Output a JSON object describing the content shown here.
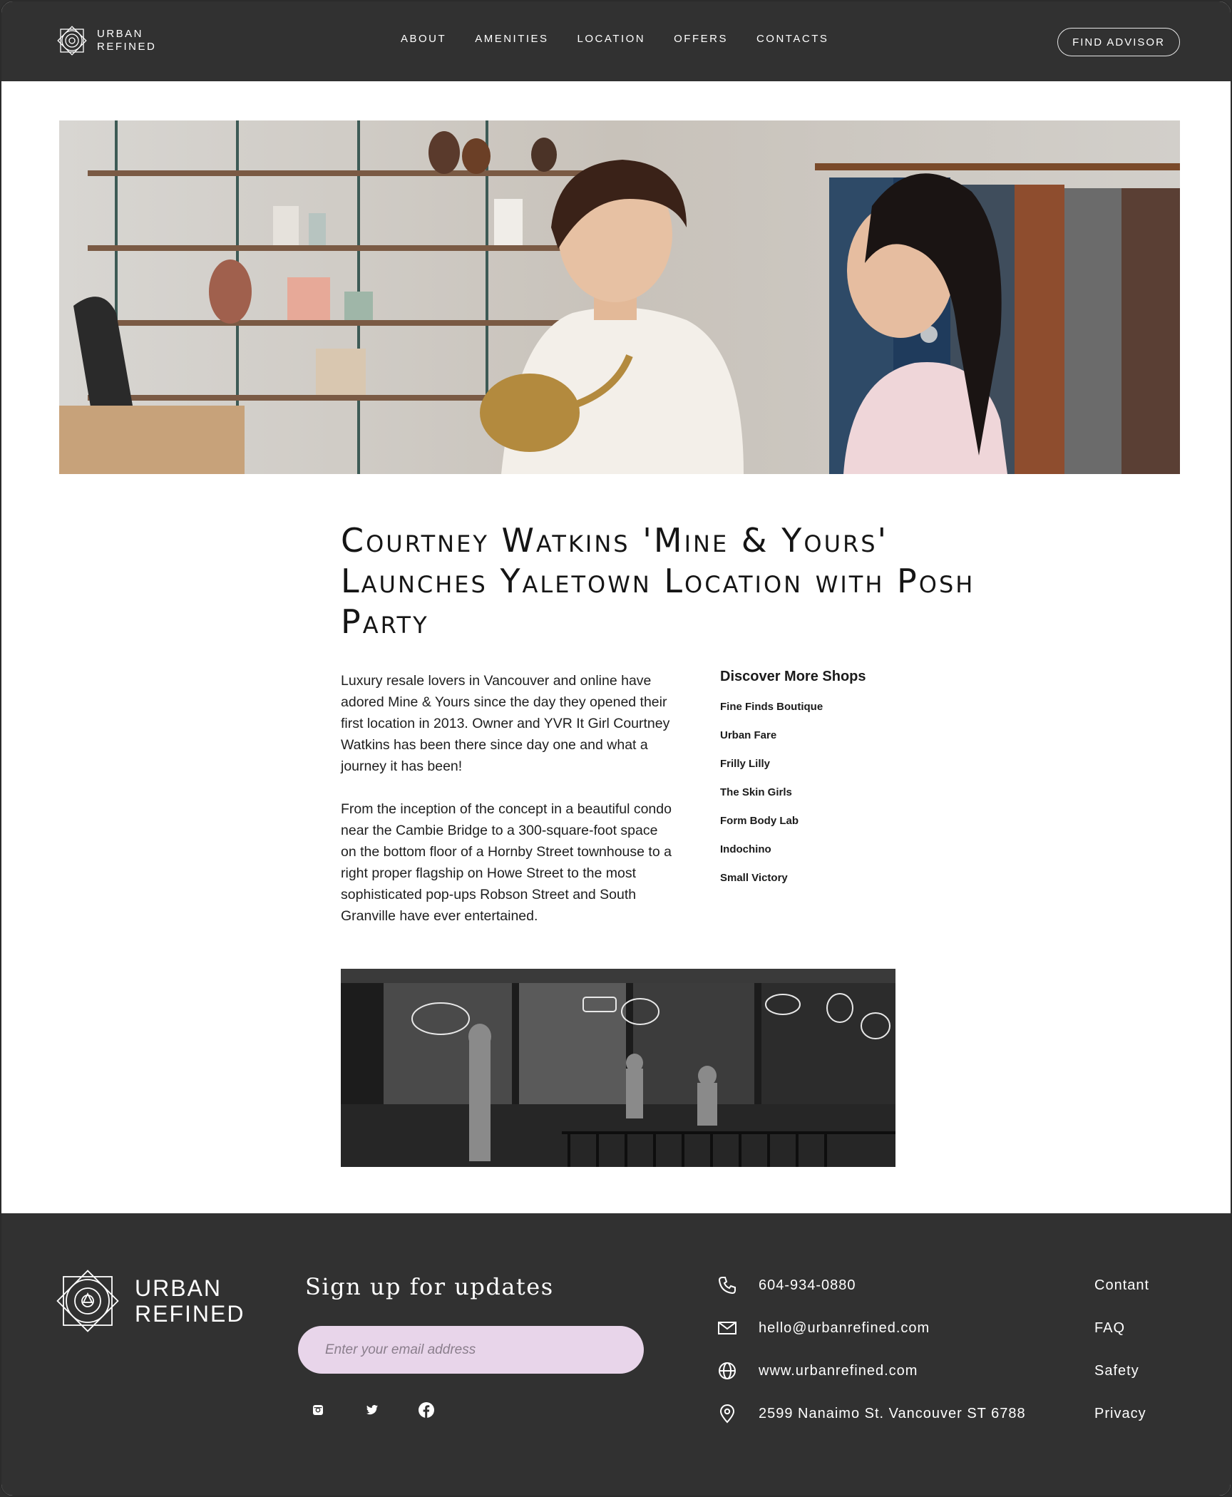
{
  "brand": {
    "line1": "URBAN",
    "line2": "REFINED"
  },
  "nav": [
    {
      "label": "ABOUT"
    },
    {
      "label": "AMENITIES"
    },
    {
      "label": "LOCATION"
    },
    {
      "label": "OFFERS"
    },
    {
      "label": "CONTACTS"
    }
  ],
  "header": {
    "cta_label": "FIND ADVISOR"
  },
  "article": {
    "title": "Courtney Watkins 'Mine & Yours' Launches Yaletown Location with Posh Party",
    "paragraphs": [
      "Luxury resale lovers in Vancouver and online have adored Mine & Yours since the day they opened their first location in 2013. Owner and YVR It Girl Courtney Watkins has been there since day one and what a journey it has been!",
      "From the inception of the concept in a beautiful condo near the Cambie Bridge to a 300-square-foot space on the bottom floor of a Hornby Street townhouse to a right proper flagship on Howe Street to the most sophisticated pop-ups Robson Street and South Granville have ever entertained."
    ]
  },
  "aside": {
    "title": "Discover More Shops",
    "shops": [
      "Fine Finds Boutique",
      "Urban Fare",
      "Frilly Lilly",
      "The Skin Girls",
      "Form Body Lab",
      "Indochino",
      "Small Victory"
    ]
  },
  "footer": {
    "signup_title": "Sign up for updates",
    "email_placeholder": "Enter your email address",
    "social_icons": [
      "instagram-icon",
      "twitter-icon",
      "facebook-icon"
    ],
    "contacts": {
      "phone": "604-934-0880",
      "email": "hello@urbanrefined.com",
      "website": "www.urbanrefined.com",
      "address": "2599 Nanaimo St. Vancouver ST 6788"
    },
    "links": [
      "Contant",
      "FAQ",
      "Safety",
      "Privacy"
    ]
  },
  "colors": {
    "dark": "#313131",
    "input_bg": "#e8d5ea",
    "page_bg": "#ffffff"
  }
}
